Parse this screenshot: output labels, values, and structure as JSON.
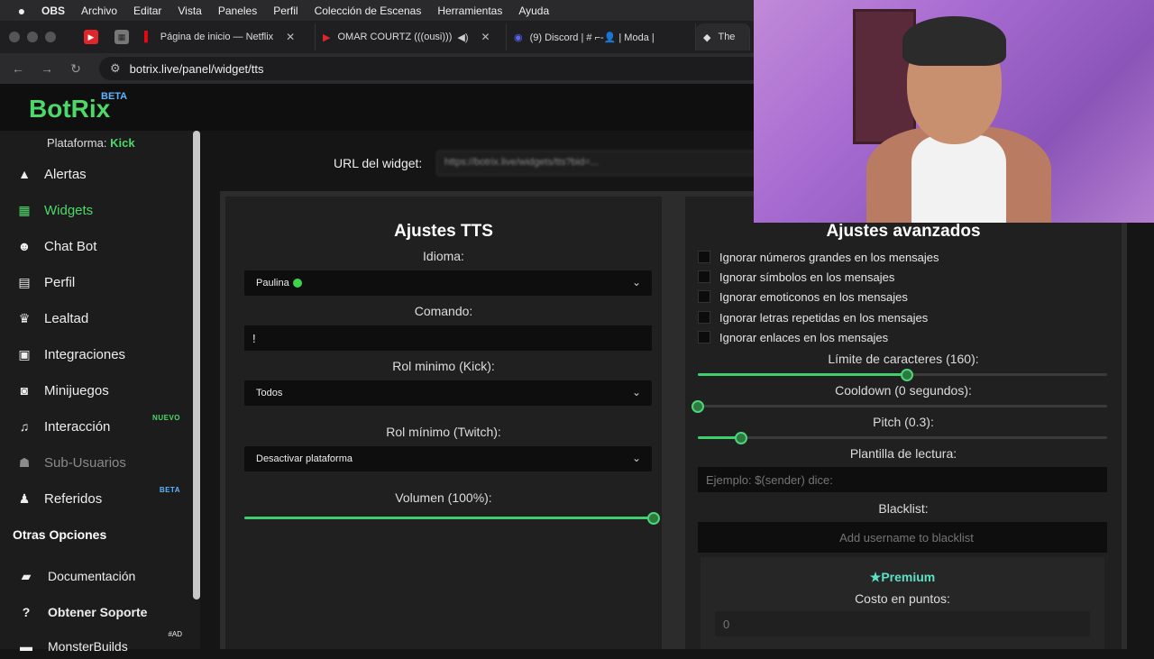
{
  "menubar": {
    "items": [
      "OBS",
      "Archivo",
      "Editar",
      "Vista",
      "Paneles",
      "Perfil",
      "Colección de Escenas",
      "Herramientas",
      "Ayuda"
    ]
  },
  "browser": {
    "tabs": [
      {
        "label": "Página de inicio — Netflix"
      },
      {
        "label": "OMAR COURTZ (((ousi)))"
      },
      {
        "label": "(9) Discord | # ⌐-👤 | Moda |"
      },
      {
        "label": "The"
      }
    ],
    "url": "botrix.live/panel/widget/tts"
  },
  "app": {
    "logo": "BotRix",
    "logo_badge": "BETA",
    "platform_label": "Plataforma:",
    "platform_value": "Kick"
  },
  "sidebar": {
    "items": [
      {
        "label": "Alertas",
        "icon": "warning-icon"
      },
      {
        "label": "Widgets",
        "icon": "grid-icon"
      },
      {
        "label": "Chat Bot",
        "icon": "robot-icon"
      },
      {
        "label": "Perfil",
        "icon": "id-card-icon"
      },
      {
        "label": "Lealtad",
        "icon": "trophy-icon"
      },
      {
        "label": "Integraciones",
        "icon": "integration-icon"
      },
      {
        "label": "Minijuegos",
        "icon": "gamepad-icon"
      },
      {
        "label": "Interacción",
        "icon": "music-icon",
        "badge": "NUEVO"
      },
      {
        "label": "Sub-Usuarios",
        "icon": "users-icon"
      },
      {
        "label": "Referidos",
        "icon": "referral-icon",
        "badge": "BETA"
      }
    ],
    "section_title": "Otras Opciones",
    "other": [
      {
        "label": "Documentación",
        "icon": "docs-icon"
      },
      {
        "label": "Obtener Soporte",
        "icon": "help-icon"
      },
      {
        "label": "MonsterBuilds",
        "icon": "monitor-icon",
        "badge": "#AD"
      }
    ]
  },
  "widget": {
    "url_label": "URL del widget:",
    "url_value": "https://botrix.live/widgets/tts?bid=..."
  },
  "tts": {
    "title": "Ajustes TTS",
    "idioma_label": "Idioma:",
    "idioma_value": "Paulina",
    "comando_label": "Comando:",
    "comando_value": "!",
    "rol_kick_label": "Rol minimo (Kick):",
    "rol_kick_value": "Todos",
    "rol_twitch_label": "Rol mínimo (Twitch):",
    "rol_twitch_value": "Desactivar plataforma",
    "volumen_label": "Volumen (100%):",
    "volumen_level": 1.0
  },
  "advanced": {
    "title": "Ajustes avanzados",
    "checkboxes": [
      "Ignorar números grandes en los mensajes",
      "Ignorar símbolos en los mensajes",
      "Ignorar emoticonos en los mensajes",
      "Ignorar letras repetidas en los mensajes",
      "Ignorar enlaces en los mensajes"
    ],
    "limit_label": "Límite de caracteres (160):",
    "limit_level": 0.51,
    "cooldown_label": "Cooldown (0 segundos):",
    "cooldown_level": 0.0,
    "pitch_label": "Pitch (0.3):",
    "pitch_level": 0.105,
    "plantilla_label": "Plantilla de lectura:",
    "plantilla_placeholder": "Ejemplo: $(sender) dice:",
    "blacklist_label": "Blacklist:",
    "blacklist_placeholder": "Add username to blacklist",
    "premium_title": "★Premium",
    "costo_label": "Costo en puntos:",
    "costo_placeholder": "0"
  },
  "colors": {
    "accent": "#4fd86a",
    "premium": "#5ce1c6",
    "beta": "#5fb5ff"
  }
}
